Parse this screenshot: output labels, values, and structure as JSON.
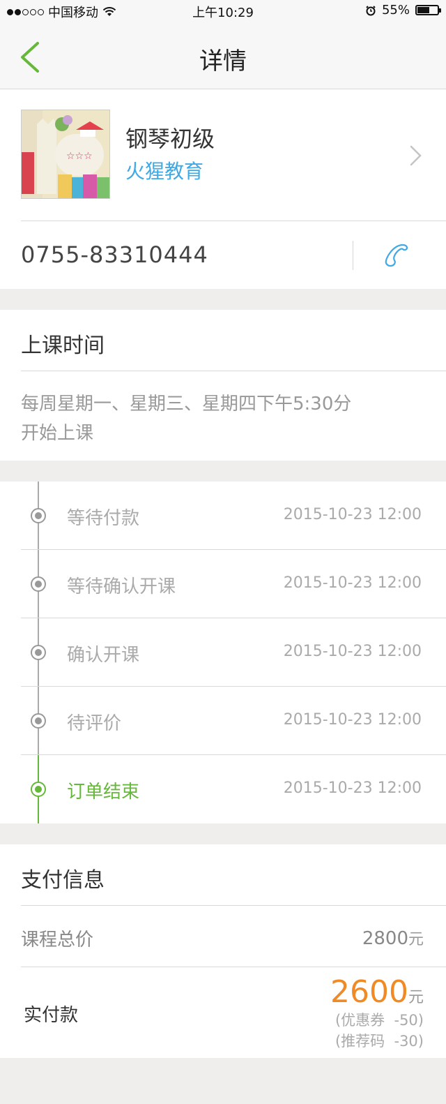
{
  "status_bar": {
    "carrier": "中国移动",
    "time": "上午10:29",
    "battery": "55%"
  },
  "nav": {
    "title": "详情"
  },
  "course": {
    "name": "钢琴初级",
    "organization": "火猩教育",
    "phone": "0755-83310444"
  },
  "schedule": {
    "title": "上课时间",
    "text_line1": "每周星期一、星期三、星期四下午5:30分",
    "text_line2": "开始上课"
  },
  "timeline": [
    {
      "label": "等待付款",
      "time": "2015-10-23 12:00",
      "active": false
    },
    {
      "label": "等待确认开课",
      "time": "2015-10-23 12:00",
      "active": false
    },
    {
      "label": "确认开课",
      "time": "2015-10-23 12:00",
      "active": false
    },
    {
      "label": "待评价",
      "time": "2015-10-23 12:00",
      "active": false
    },
    {
      "label": "订单结束",
      "time": "2015-10-23 12:00",
      "active": true
    }
  ],
  "payment": {
    "title": "支付信息",
    "total_label": "课程总价",
    "total_value": "2800",
    "unit": "元",
    "paid_label": "实付款",
    "paid_value": "2600",
    "coupon": "(优惠券  -50)",
    "referral": "(推荐码  -30)"
  },
  "colors": {
    "accent_green": "#66b83a",
    "link_blue": "#3fa9e6",
    "price_orange": "#ef8a24"
  },
  "icons": [
    "back-chevron-icon",
    "chevron-right-icon",
    "phone-icon",
    "wifi-icon",
    "alarm-icon",
    "battery-icon"
  ]
}
